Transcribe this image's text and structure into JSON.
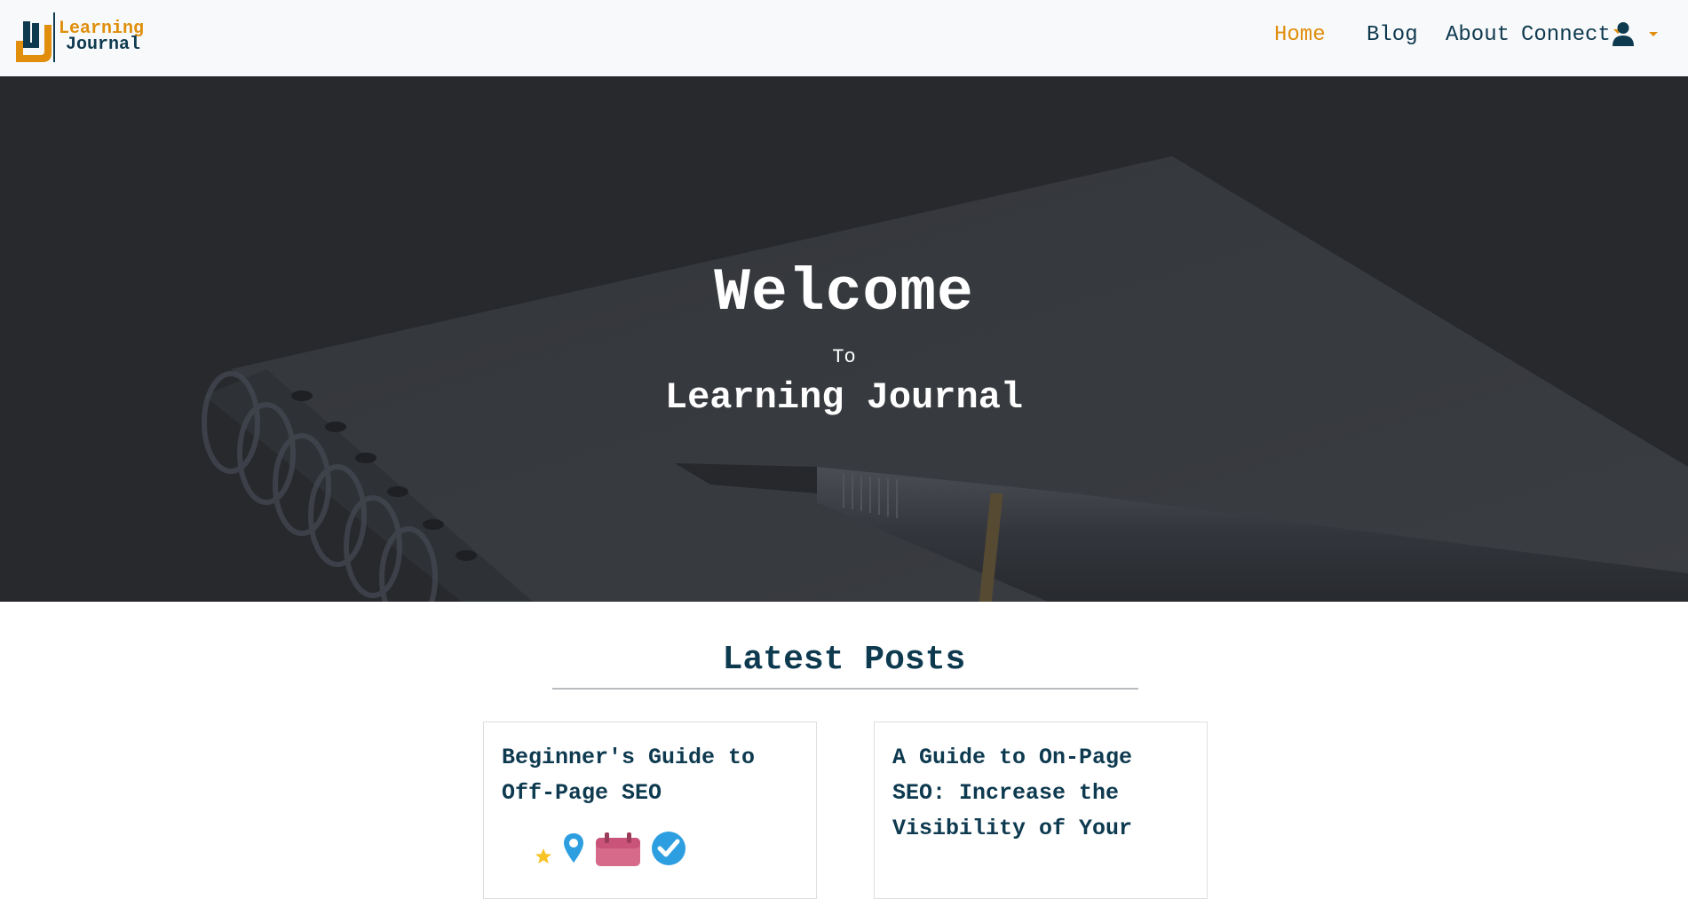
{
  "brand": {
    "line1": "Learning",
    "line2": "Journal",
    "colors": {
      "accent": "#e08e0b",
      "primary": "#0e3a50"
    }
  },
  "nav": {
    "items": [
      {
        "label": "Home",
        "active": true
      },
      {
        "label": "Blog",
        "active": false
      },
      {
        "label": "About",
        "active": false
      },
      {
        "label": "Connect",
        "active": false,
        "dropdown": true
      }
    ],
    "user_menu_icon": "user-icon"
  },
  "hero": {
    "welcome": "Welcome",
    "to": "To",
    "name": "Learning Journal"
  },
  "latest": {
    "heading": "Latest Posts",
    "posts": [
      {
        "title": "Beginner's Guide to Off-Page SEO",
        "icons": [
          "star-icon",
          "map-pin-icon",
          "calendar-icon",
          "check-badge-icon"
        ]
      },
      {
        "title": "A Guide to On-Page SEO: Increase the Visibility of Your"
      }
    ]
  }
}
